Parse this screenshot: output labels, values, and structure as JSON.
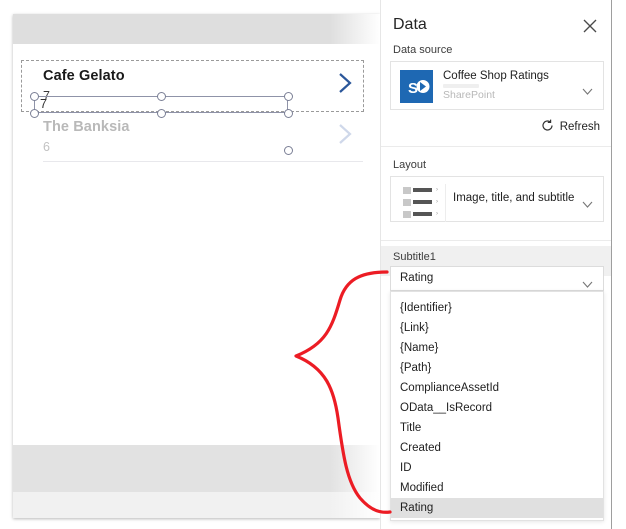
{
  "canvas": {
    "gallery": {
      "items": [
        {
          "title": "Cafe Gelato",
          "subtitle": "7",
          "chevron": "chevron-right-icon"
        },
        {
          "title": "The Banksia",
          "subtitle": "6",
          "chevron": "chevron-right-icon"
        }
      ]
    }
  },
  "pane": {
    "title": "Data",
    "close_icon": "close-icon",
    "data_source": {
      "label": "Data source",
      "name": "Coffee Shop Ratings",
      "provider": "SharePoint",
      "icon": "sharepoint-icon",
      "expand_icon": "chevron-down-icon"
    },
    "refresh": {
      "label": "Refresh",
      "icon": "refresh-icon"
    },
    "layout": {
      "label": "Layout",
      "value": "Image, title, and subtitle",
      "expand_icon": "chevron-down-icon"
    },
    "subtitle_section": {
      "label": "Subtitle1",
      "selected_field": "Rating",
      "expand_icon": "chevron-down-icon",
      "options": [
        "{Identifier}",
        "{Link}",
        "{Name}",
        "{Path}",
        "ComplianceAssetId",
        "OData__IsRecord",
        "Title",
        "Created",
        "ID",
        "Modified",
        "Rating"
      ],
      "highlighted_option": "Rating"
    }
  },
  "annotation": {
    "shape": "red-curly-brace",
    "color": "#ec1c24"
  },
  "colors": {
    "accent_blue": "#2b579a",
    "sharepoint_blue": "#1e68b3",
    "annotation_red": "#ec1c24",
    "highlight_gray": "#e0e0e0"
  }
}
